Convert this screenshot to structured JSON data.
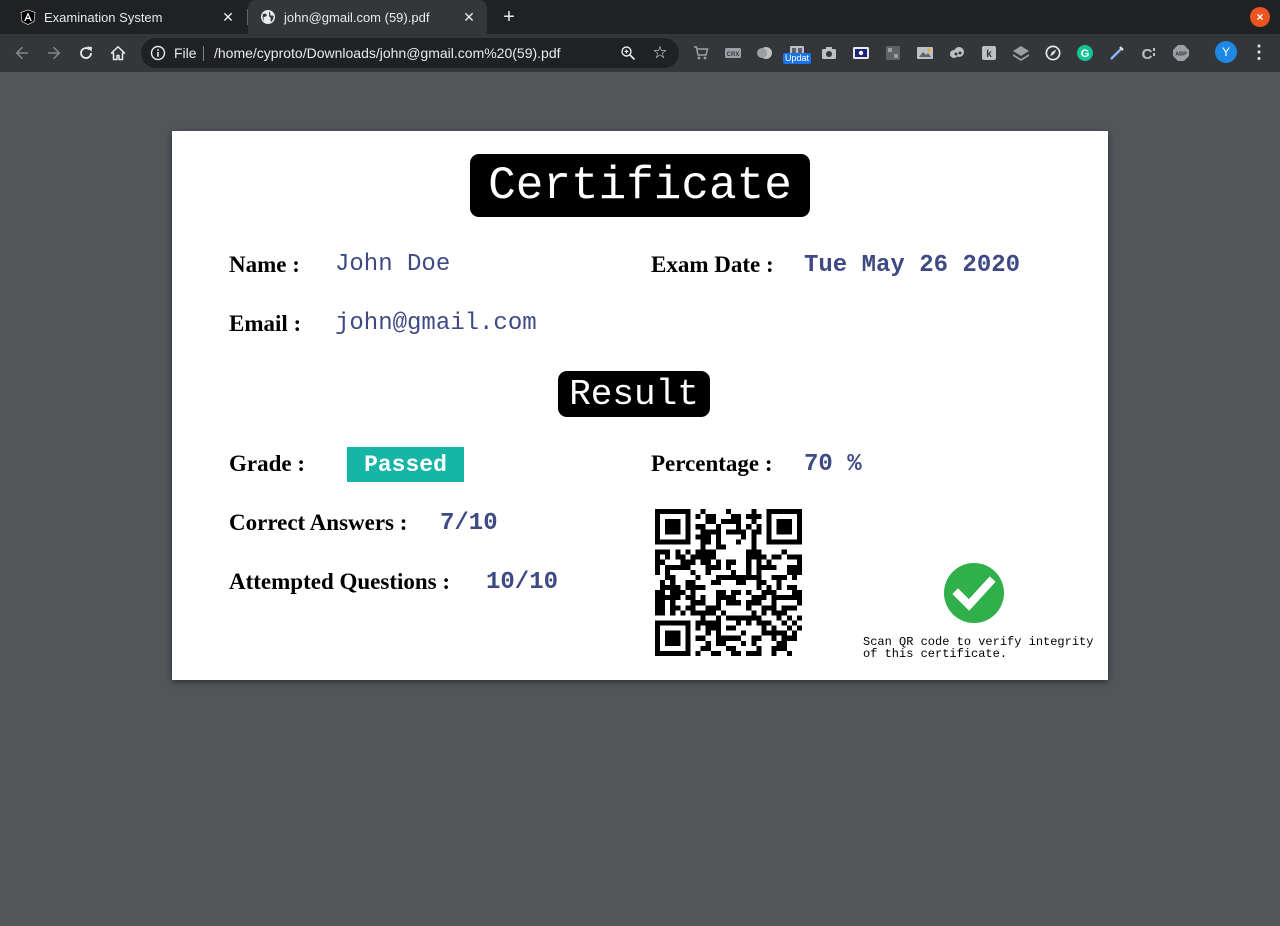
{
  "browser": {
    "tabs": [
      {
        "title": "Examination System",
        "active": false,
        "icon": "angular-icon"
      },
      {
        "title": "john@gmail.com (59).pdf",
        "active": true,
        "icon": "globe-icon"
      }
    ],
    "new_tab": "+",
    "window_close": "×",
    "address_bar": {
      "scheme_label": "File",
      "url": "/home/cyproto/Downloads/john@gmail.com%20(59).pdf"
    },
    "extension_badge": "Updat",
    "profile_initial": "Y",
    "menu": "⋮"
  },
  "certificate": {
    "title": "Certificate",
    "name_label": "Name :",
    "name_value": "John Doe",
    "exam_date_label": "Exam Date :",
    "exam_date_value": "Tue May 26 2020",
    "email_label": "Email :",
    "email_value": "john@gmail.com",
    "result_title": "Result",
    "grade_label": "Grade :",
    "grade_value": "Passed",
    "percentage_label": "Percentage :",
    "percentage_value": "70 %",
    "correct_label": "Correct Answers :",
    "correct_value": "7/10",
    "attempted_label": "Attempted Questions :",
    "attempted_value": "10/10",
    "verify_note_line1": "Scan QR code to verify integrity",
    "verify_note_line2": "of this certificate."
  },
  "colors": {
    "value_text": "#3f4a85",
    "passed_badge": "#17b5a6",
    "check_mark": "#2fb04a",
    "viewer_background": "#525659"
  }
}
